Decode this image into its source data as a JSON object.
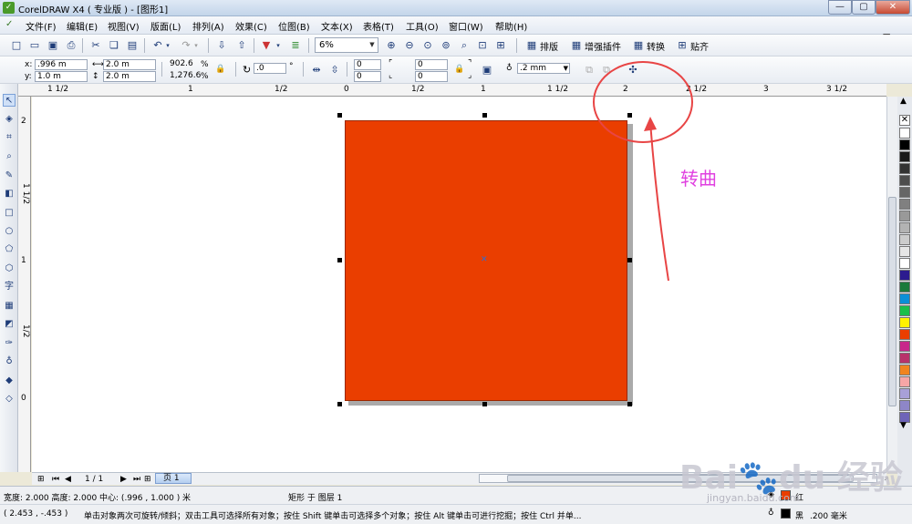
{
  "window": {
    "title": "CorelDRAW X4 ( 专业版 ) - [图形1]",
    "min": "—",
    "max": "▢",
    "close": "✕"
  },
  "menu": [
    "文件(F)",
    "编辑(E)",
    "视图(V)",
    "版面(L)",
    "排列(A)",
    "效果(C)",
    "位图(B)",
    "文本(X)",
    "表格(T)",
    "工具(O)",
    "窗口(W)",
    "帮助(H)"
  ],
  "toolbar": {
    "zoom": "6%",
    "plugin_buttons": [
      "排版",
      "增强插件",
      "转换",
      "贴齐"
    ]
  },
  "properties": {
    "x_label": "x:",
    "x": ".996 m",
    "y_label": "y:",
    "y": "1.0 m",
    "width": "2.0 m",
    "height": "2.0 m",
    "scale_w": "902.6",
    "scale_h": "1,276.6",
    "pct": "%",
    "rotation": ".0",
    "deg": "°",
    "corner_values": [
      "0",
      "0",
      "0",
      "0"
    ],
    "outline": ".2 mm"
  },
  "rulers": {
    "h": [
      "1 1/2",
      "1",
      "1/2",
      "0",
      "1/2",
      "1",
      "1 1/2",
      "2",
      "2 1/2",
      "3",
      "3 1/2"
    ],
    "v": [
      "2",
      "1 1/2",
      "1",
      "1/2",
      "0"
    ]
  },
  "annotation": "转曲",
  "pagebar": {
    "count": "1 / 1",
    "tab": "页 1"
  },
  "status": {
    "size": "宽度: 2.000  高度: 2.000  中心: (.996 , 1.000 ) 米",
    "object": "矩形 于 图层 1",
    "coords": "( 2.453 , -.453 )",
    "hint": "单击对象两次可旋转/倾斜；双击工具可选择所有对象；按住 Shift 键单击可选择多个对象；按住 Alt 键单击可进行挖掘；按住 Ctrl 并单...",
    "fill_label": "红",
    "outline_label": "黑",
    "outline_size": ".200 毫米"
  },
  "colors": {
    "fill": "#ea3e00",
    "annotation": "#e040e0",
    "callout": "#e84545"
  },
  "palette": [
    "#ffffff",
    "#000000",
    "#1a1a1a",
    "#333333",
    "#4d4d4d",
    "#666666",
    "#808080",
    "#999999",
    "#b3b3b3",
    "#cccccc",
    "#e6e6e6",
    "#ffffff",
    "#2c1b8f",
    "#1b7a3a",
    "#0b8fd6",
    "#1bbf4a",
    "#fff200",
    "#ea3e00",
    "#c8278b",
    "#b8336a",
    "#f0841e",
    "#f7a6a6",
    "#a8a0d8",
    "#8e86c8",
    "#6e64b8"
  ],
  "watermark": {
    "text": "Bai du 经验",
    "url": "jingyan.baidu.com"
  }
}
